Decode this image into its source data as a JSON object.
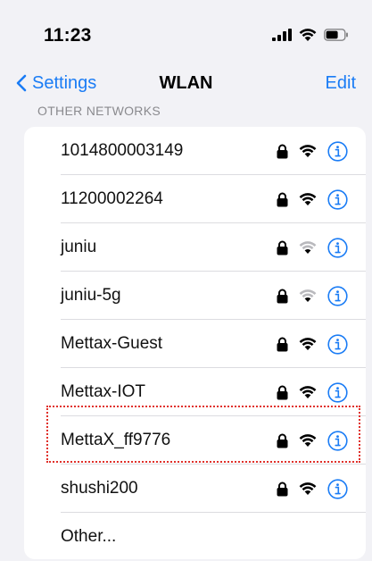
{
  "status_bar": {
    "time": "11:23"
  },
  "nav": {
    "back_label": "Settings",
    "title": "WLAN",
    "edit_label": "Edit"
  },
  "section_header": "OTHER NETWORKS",
  "networks": [
    {
      "name": "1014800003149",
      "secured": true,
      "signal": "full"
    },
    {
      "name": "11200002264",
      "secured": true,
      "signal": "full"
    },
    {
      "name": "juniu",
      "secured": true,
      "signal": "weak"
    },
    {
      "name": "juniu-5g",
      "secured": true,
      "signal": "weak"
    },
    {
      "name": "Mettax-Guest",
      "secured": true,
      "signal": "full"
    },
    {
      "name": "Mettax-IOT",
      "secured": true,
      "signal": "full"
    },
    {
      "name": "MettaX_ff9776",
      "secured": true,
      "signal": "full",
      "highlighted": true
    },
    {
      "name": "shushi200",
      "secured": true,
      "signal": "full"
    }
  ],
  "other_label": "Other...",
  "colors": {
    "accent": "#1a7cf5",
    "highlight_border": "#e0302a",
    "background": "#f2f2f6"
  }
}
